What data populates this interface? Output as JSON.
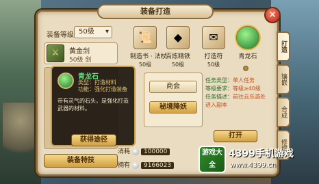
{
  "window": {
    "title": "装备打造"
  },
  "left_panel": {
    "level_label": "装备等级",
    "level_value": "50级",
    "item": {
      "name": "黄金剑",
      "level": "50级",
      "type": "剑"
    },
    "equip_special_button": "装备特技"
  },
  "materials": [
    {
      "name": "制造书 · 法杖",
      "level": "50级"
    },
    {
      "name": "百炼精铁",
      "level": "50级"
    },
    {
      "name": "打造符",
      "level": "50级"
    },
    {
      "name": "青龙石",
      "level": ""
    }
  ],
  "tooltip": {
    "name": "青龙石",
    "type": "类型：打造材料",
    "function": "功能：强化打造装备",
    "description": "带有灵气的石头，是强化打造武器的材料。",
    "red_note": "",
    "obtain_button": "获得途径"
  },
  "sources": {
    "buttons": [
      "商会",
      "秘境降妖"
    ],
    "selected": 1
  },
  "task_info": {
    "type_label": "任务类型：",
    "type_value": "单人任务",
    "level_label": "等级要求：",
    "level_value": "等级≥40级",
    "desc_label": "任务描述：",
    "desc_value": "前往云乐游处进入副本"
  },
  "open_button": "打开",
  "cost": {
    "consume_label": "消耗",
    "consume_value": "100000",
    "own_label": "拥有",
    "own_value": "9166023"
  },
  "tabs": [
    "打造",
    "镶嵌",
    "合成",
    "修理"
  ],
  "watermark": {
    "badge": "游戏大全",
    "brand": "4399手机游戏",
    "url": "www.4399.cn"
  }
}
